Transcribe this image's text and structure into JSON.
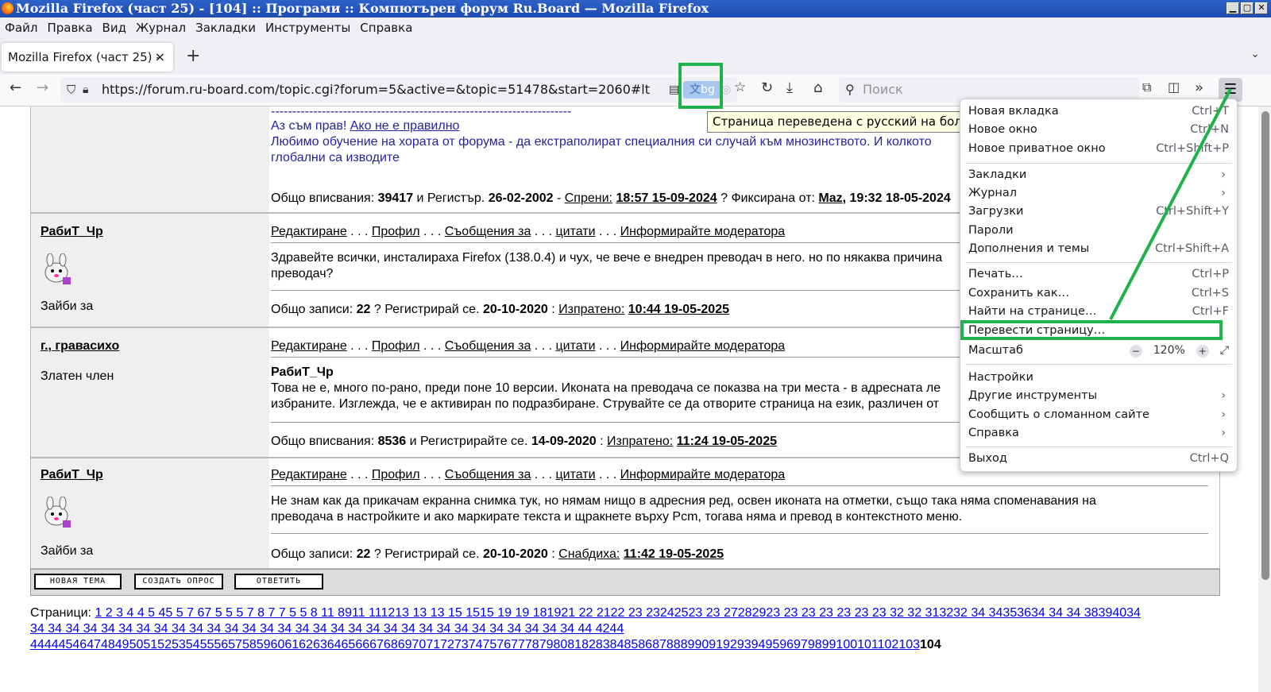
{
  "window": {
    "title": "Mozilla Firefox (част 25) - [104] :: Програми :: Компютърен форум Ru.Board — Mozilla Firefox",
    "min": "▁",
    "max": "▢",
    "close": "✕"
  },
  "menubar": [
    "Файл",
    "Правка",
    "Вид",
    "Журнал",
    "Закладки",
    "Инструменты",
    "Справка"
  ],
  "tab": {
    "title": "Mozilla Firefox (част 25) -",
    "close": "×",
    "new": "+"
  },
  "nav": {
    "url": "https://forum.ru-board.com/topic.cgi?forum=5&active=&topic=51478&start=2060#lt",
    "translate_chip": "bg",
    "search_placeholder": "Поиск"
  },
  "tooltip": "Страница переведена с русский на болгарский",
  "posts": [
    {
      "quote_dashes": "-----------------------------------------------------------------------",
      "quote_line1_text": "Аз съм прав! ",
      "quote_line1_link": "Ако не е правилно",
      "quote_line2": "Любимо обучение на хората от форума - да екстраполират специалния си случай към мнозинството. И колкото",
      "quote_line3": "глобални са изводите",
      "stats": {
        "l1": "Общо вписвания: ",
        "n1": "39417",
        "l2": " и Регистър. ",
        "d1": "26-02-2002",
        "l3": " - ",
        "l4": "Спрени:",
        "t": "18:57 15-09-2024",
        "l5": " ? Фиксирана от: ",
        "who": "Maz",
        "t2": ", 19:32 18-05-2024"
      }
    },
    {
      "name": "РабиТ_Чр",
      "rank": "Зайби за",
      "links": [
        "Редактиране",
        "Профил",
        "Съобщения за",
        "цитати",
        "Информирайте модератора"
      ],
      "text": "Здравейте всички, инсталираха Firefox (138.0.4) и чух, че вече е внедрен преводач в него. но по някаква причина преводач?",
      "stats": {
        "l1": "Общо записи: ",
        "n1": "22",
        "l2": " ? Регистрирай се. ",
        "d1": "20-10-2020",
        "l3": " : ",
        "l4": "Изпратено:",
        "t": "10:44 19-05-2025"
      }
    },
    {
      "name": "г., гравасихо",
      "rank": "Златен член",
      "links": [
        "Редактиране",
        "Профил",
        "Съобщения за",
        "цитати",
        "Информирайте модератора"
      ],
      "quote_name": "РабиТ_Чр",
      "text": "Това не е, много по-рано, преди поне 10 версии. Иконата на преводача се показва на три места - в адресната ле избраните. Изглежда, че е активиран по подразбиране. Струвайте се да отворите страница на език, различен от",
      "stats": {
        "l1": "Общо вписвания: ",
        "n1": "8536",
        "l2": " и Регистрирайте се. ",
        "d1": "14-09-2020",
        "l3": " : ",
        "l4": "Изпратено:",
        "t": "11:24 19-05-2025"
      }
    },
    {
      "name": "РабиТ_Чр",
      "rank": "Зайби за",
      "links": [
        "Редактиране",
        "Профил",
        "Съобщения за",
        "цитати",
        "Информирайте модератора"
      ],
      "text": "Не знам как да прикачам екранна снимка тук, но нямам нищо в адресния ред, освен иконата на отметки, също така няма споменавания на преводача в настройките и ако маркирате текста и щракнете върху Pcm, тогава няма и превод в контекстното меню.",
      "stats": {
        "l1": "Общо записи: ",
        "n1": "22",
        "l2": " ? Регистрирай се. ",
        "d1": "20-10-2020",
        "l3": " : ",
        "l4": "Снабдиха:",
        "t": "11:42 19-05-2025"
      }
    }
  ],
  "link_sep": " . . . ",
  "footer_buttons": [
    "НОВАЯ ТЕМА",
    "СОЗДАТЬ ОПРОС",
    "ОТВЕТИТЬ"
  ],
  "pages": {
    "label": "Страници: ",
    "line1": "1 2 3 4 4 5 45 5 7 67 5 5 5 7 8 7 7 5 5 8 11 8911 111213 13 13 15 1515 19 19 181921 22 2122 23 23242523 23 27282923 23 23 23 23 23 23 32 32 313232 34 34353634 34 34 38394034",
    "line2": "34 34 34 34 34 34 34 34 34 34 34 34 34 34 34 34 34 34 34 34 34 34 34 34 34 34 34 34 34 34 34 44 4244",
    "line3": "444445464748495051525354555657585960616263646566676869707172737475767778798081828384858687888990919293949596979899100101102103",
    "current": "104"
  },
  "app_menu": {
    "items": [
      {
        "label": "Новая вкладка",
        "shortcut": "Ctrl+T"
      },
      {
        "label": "Новое окно",
        "shortcut": "Ctrl+N"
      },
      {
        "label": "Новое приватное окно",
        "shortcut": "Ctrl+Shift+P"
      },
      {
        "label": "Закладки",
        "shortcut": "›"
      },
      {
        "label": "Журнал",
        "shortcut": "›"
      },
      {
        "label": "Загрузки",
        "shortcut": "Ctrl+Shift+Y"
      },
      {
        "label": "Пароли",
        "shortcut": ""
      },
      {
        "label": "Дополнения и темы",
        "shortcut": "Ctrl+Shift+A"
      },
      {
        "label": "Печать…",
        "shortcut": "Ctrl+P"
      },
      {
        "label": "Сохранить как…",
        "shortcut": "Ctrl+S"
      },
      {
        "label": "Найти на странице…",
        "shortcut": "Ctrl+F"
      },
      {
        "label": "Перевести страницу…",
        "shortcut": ""
      },
      {
        "label": "Масштаб",
        "shortcut": ""
      },
      {
        "label": "Настройки",
        "shortcut": ""
      },
      {
        "label": "Другие инструменты",
        "shortcut": "›"
      },
      {
        "label": "Сообщить о сломанном сайте",
        "shortcut": "›"
      },
      {
        "label": "Справка",
        "shortcut": "›"
      },
      {
        "label": "Выход",
        "shortcut": "Ctrl+Q"
      }
    ],
    "zoom": {
      "minus": "−",
      "value": "120%",
      "plus": "+",
      "full": "⤢"
    }
  },
  "colors": {
    "highlight": "#21b14c",
    "titlebar": "#2d62c9",
    "link": "#0000ee",
    "quote": "#2323a0"
  }
}
